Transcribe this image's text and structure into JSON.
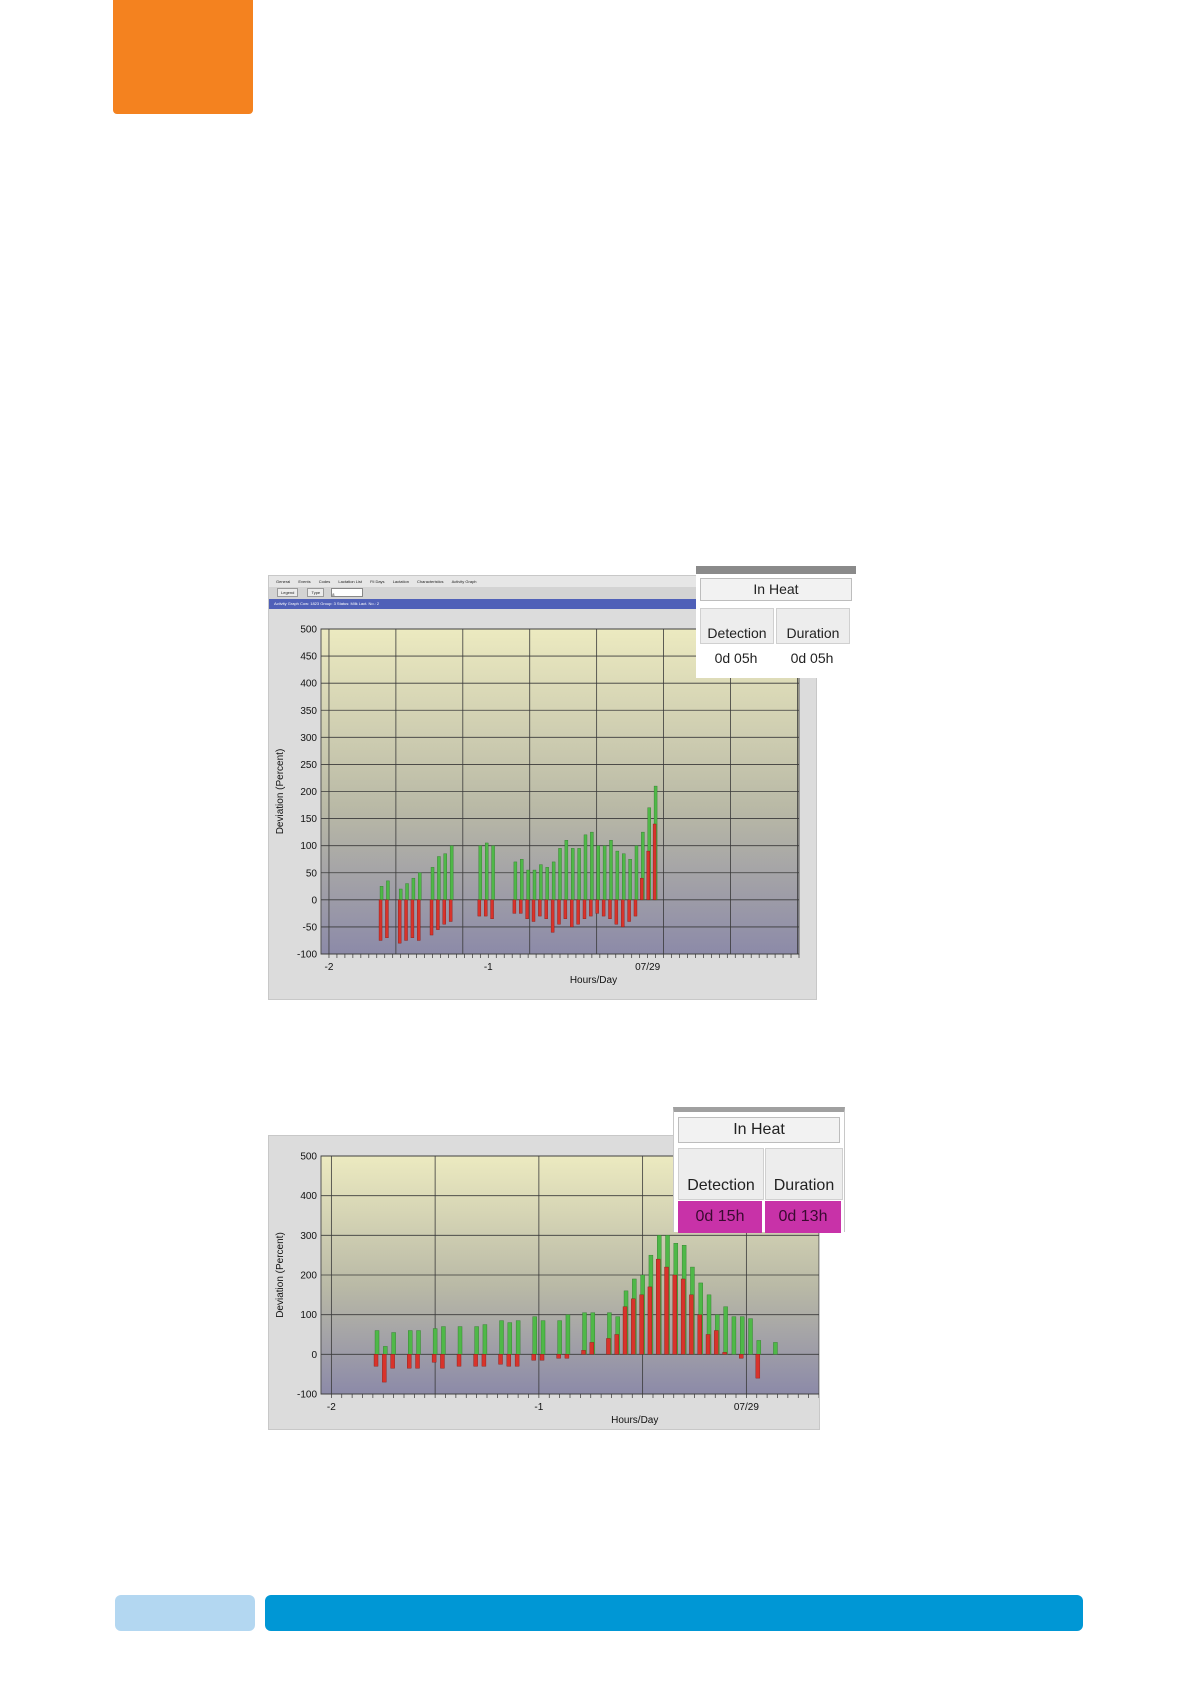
{
  "page": {
    "colors": {
      "orange_accent": "#f4821f",
      "footer_light": "#b3d7f1",
      "footer_blue": "#0097d5"
    }
  },
  "screenshot1": {
    "menu": [
      "General",
      "Events",
      "Codes",
      "Lactation List",
      "Fil Days",
      "Lactation",
      "Characteristics",
      "Activity Graph"
    ],
    "toolbar": {
      "legend_label": "Legend",
      "type_label": "Type",
      "input_value": "8"
    },
    "info_line": "Activity Graph   Cow: 1823   Group: 3   Status: Milk   Lact. No.: 2",
    "in_heat": {
      "title": "In Heat",
      "detection_header": "Detection",
      "duration_header": "Duration",
      "detection_value": "0d 05h",
      "duration_value": "0d 05h"
    }
  },
  "screenshot2": {
    "in_heat": {
      "title": "In Heat",
      "detection_header": "Detection",
      "duration_header": "Duration",
      "detection_value": "0d 15h",
      "duration_value": "0d 13h",
      "highlight_color": "#c832a8"
    }
  },
  "chart_data": [
    {
      "type": "bar",
      "ylabel": "Deviation  (Percent)",
      "xlabel": "Hours/Day",
      "ylim": [
        -100,
        500
      ],
      "yticks": [
        500,
        450,
        400,
        350,
        300,
        250,
        200,
        150,
        100,
        50,
        0,
        -50,
        -100
      ],
      "x_tick_labels": [
        {
          "label": "-2",
          "x": -2
        },
        {
          "label": "-1",
          "x": -1
        },
        {
          "label": "07/29",
          "x": 0
        }
      ],
      "xlim": [
        -2.05,
        0.95
      ],
      "series": [
        {
          "color": "green",
          "x": [
            -1.67,
            -1.63,
            -1.55,
            -1.51,
            -1.47,
            -1.43,
            -1.35,
            -1.31,
            -1.27,
            -1.23,
            -1.05,
            -1.01,
            -0.97,
            -0.83,
            -0.79,
            -0.75,
            -0.71,
            -0.67,
            -0.63,
            -0.59,
            -0.55,
            -0.51,
            -0.47,
            -0.43,
            -0.39,
            -0.35,
            -0.31,
            -0.27,
            -0.23,
            -0.19,
            -0.15,
            -0.11,
            -0.07,
            -0.03,
            0.01,
            0.05,
            0.09,
            0.13,
            0.17
          ],
          "values": [
            25,
            35,
            20,
            30,
            40,
            50,
            60,
            80,
            85,
            100,
            100,
            105,
            100,
            70,
            75,
            55,
            55,
            65,
            60,
            70,
            95,
            110,
            95,
            95,
            120,
            125,
            100,
            100,
            110,
            90,
            85,
            75,
            100,
            125,
            170,
            210,
            0,
            0,
            0
          ]
        },
        {
          "color": "red",
          "x": [
            -1.67,
            -1.63,
            -1.55,
            -1.51,
            -1.47,
            -1.43,
            -1.35,
            -1.31,
            -1.27,
            -1.23,
            -1.05,
            -1.01,
            -0.97,
            -0.83,
            -0.79,
            -0.75,
            -0.71,
            -0.67,
            -0.63,
            -0.59,
            -0.55,
            -0.51,
            -0.47,
            -0.43,
            -0.39,
            -0.35,
            -0.31,
            -0.27,
            -0.23,
            -0.19,
            -0.15,
            -0.11,
            -0.07,
            -0.03,
            0.01,
            0.05,
            0.09,
            0.13,
            0.17
          ],
          "values": [
            -75,
            -70,
            -80,
            -75,
            -70,
            -75,
            -65,
            -55,
            -45,
            -40,
            -30,
            -30,
            -35,
            -25,
            -25,
            -35,
            -40,
            -30,
            -35,
            -60,
            -45,
            -35,
            -50,
            -45,
            -35,
            -30,
            -25,
            -30,
            -35,
            -45,
            -50,
            -40,
            -30,
            40,
            90,
            140,
            0,
            0,
            0
          ]
        }
      ]
    },
    {
      "type": "bar",
      "ylabel": "Deviation  (Percent)",
      "xlabel": "Hours/Day",
      "ylim": [
        -100,
        500
      ],
      "yticks": [
        500,
        400,
        300,
        200,
        100,
        0,
        -100
      ],
      "x_tick_labels": [
        {
          "label": "-2",
          "x": -2
        },
        {
          "label": "-1",
          "x": -1
        },
        {
          "label": "07/29",
          "x": 0
        }
      ],
      "xlim": [
        -2.05,
        0.35
      ],
      "series": [
        {
          "color": "green",
          "x": [
            -1.78,
            -1.74,
            -1.7,
            -1.62,
            -1.58,
            -1.5,
            -1.46,
            -1.38,
            -1.3,
            -1.26,
            -1.18,
            -1.14,
            -1.1,
            -1.02,
            -0.98,
            -0.9,
            -0.86,
            -0.78,
            -0.74,
            -0.66,
            -0.62,
            -0.58,
            -0.54,
            -0.5,
            -0.46,
            -0.42,
            -0.38,
            -0.34,
            -0.3,
            -0.26,
            -0.22,
            -0.18,
            -0.14,
            -0.1,
            -0.06,
            -0.02,
            0.02,
            0.06,
            0.14
          ],
          "values": [
            60,
            20,
            55,
            60,
            60,
            65,
            70,
            70,
            70,
            75,
            85,
            80,
            85,
            95,
            85,
            85,
            100,
            105,
            105,
            105,
            95,
            160,
            190,
            200,
            250,
            300,
            300,
            280,
            275,
            220,
            180,
            150,
            100,
            120,
            95,
            95,
            90,
            35,
            30
          ],
          "ext_x": [
            0.1,
            0.14
          ],
          "ext_values": [
            95,
            35
          ]
        },
        {
          "color": "red",
          "x": [
            -1.78,
            -1.74,
            -1.7,
            -1.62,
            -1.58,
            -1.5,
            -1.46,
            -1.38,
            -1.3,
            -1.26,
            -1.18,
            -1.14,
            -1.1,
            -1.02,
            -0.98,
            -0.9,
            -0.86,
            -0.78,
            -0.74,
            -0.66,
            -0.62,
            -0.58,
            -0.54,
            -0.5,
            -0.46,
            -0.42,
            -0.38,
            -0.34,
            -0.3,
            -0.26,
            -0.22,
            -0.18,
            -0.14,
            -0.1,
            -0.06,
            -0.02,
            0.02,
            0.06,
            0.14
          ],
          "values": [
            -30,
            -70,
            -35,
            -35,
            -35,
            -20,
            -35,
            -30,
            -30,
            -30,
            -25,
            -30,
            -30,
            -15,
            -15,
            -10,
            -10,
            10,
            30,
            40,
            50,
            120,
            140,
            150,
            170,
            240,
            220,
            200,
            190,
            150,
            100,
            50,
            60,
            5,
            0,
            -10,
            0,
            -60,
            0
          ]
        }
      ]
    }
  ]
}
